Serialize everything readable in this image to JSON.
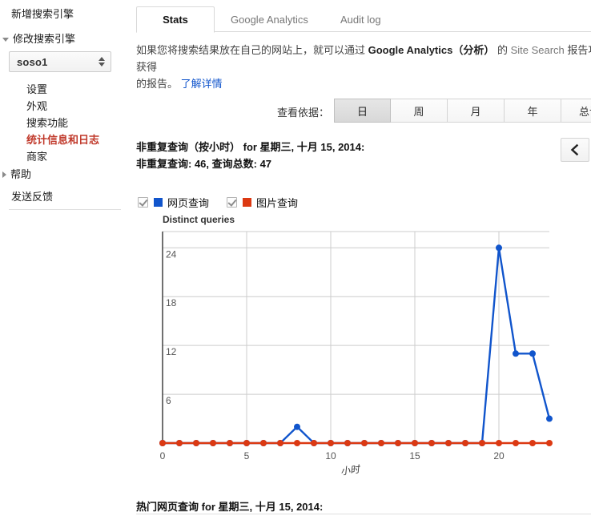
{
  "sidebar": {
    "add_engine": "新增搜索引擎",
    "edit_engine": "修改搜索引擎",
    "engine_select_value": "soso1",
    "sub_items": [
      {
        "label": "设置",
        "active": false
      },
      {
        "label": "外观",
        "active": false
      },
      {
        "label": "搜索功能",
        "active": false
      },
      {
        "label": "统计信息和日志",
        "active": true
      },
      {
        "label": "商家",
        "active": false
      }
    ],
    "help": "帮助",
    "send_feedback": "发送反馈"
  },
  "tabs": [
    {
      "label": "Stats",
      "active": true
    },
    {
      "label": "Google Analytics",
      "active": false
    },
    {
      "label": "Audit log",
      "active": false
    }
  ],
  "intro": {
    "part1": "如果您将搜索结果放在自己的网站上，就可以通过 ",
    "brand": "Google Analytics（分析）",
    "part2": " 的 ",
    "feature": "Site Search",
    "part3": " 报告功能获得",
    "part4": "的报告。",
    "link": "了解详情"
  },
  "range": {
    "label": "查看依据：",
    "options": [
      {
        "label": "日",
        "selected": true
      },
      {
        "label": "周",
        "selected": false
      },
      {
        "label": "月",
        "selected": false
      },
      {
        "label": "年",
        "selected": false
      },
      {
        "label": "总计",
        "selected": false
      }
    ]
  },
  "chart_header": {
    "title": "非重复查询（按小时） for 星期三, 十月 15, 2014:",
    "subtitle": "非重复查询: 46, 查询总数: 47",
    "back_icon": "chevron-left-icon"
  },
  "legend": [
    {
      "label": "网页查询",
      "color": "#1155cc",
      "checked": true
    },
    {
      "label": "图片查询",
      "color": "#dc3912",
      "checked": true
    }
  ],
  "chart_data": {
    "type": "line",
    "title": "Distinct queries",
    "xlabel": "小时",
    "ylabel": "Distinct queries",
    "x": [
      0,
      1,
      2,
      3,
      4,
      5,
      6,
      7,
      8,
      9,
      10,
      11,
      12,
      13,
      14,
      15,
      16,
      17,
      18,
      19,
      20,
      21,
      22,
      23
    ],
    "xticks": [
      0,
      5,
      10,
      15,
      20
    ],
    "yticks": [
      0,
      6,
      12,
      18,
      24
    ],
    "xlim": [
      0,
      23
    ],
    "ylim": [
      0,
      26
    ],
    "grid": true,
    "legend_position": "top",
    "series": [
      {
        "name": "网页查询",
        "color": "#1155cc",
        "values": [
          0,
          0,
          0,
          0,
          0,
          0,
          0,
          0,
          2,
          0,
          0,
          0,
          0,
          0,
          0,
          0,
          0,
          0,
          0,
          0,
          24,
          11,
          11,
          3
        ]
      },
      {
        "name": "图片查询",
        "color": "#dc3912",
        "values": [
          0,
          0,
          0,
          0,
          0,
          0,
          0,
          0,
          0,
          0,
          0,
          0,
          0,
          0,
          0,
          0,
          0,
          0,
          0,
          0,
          0,
          0,
          0,
          0
        ]
      }
    ]
  },
  "bottom": {
    "title": "热门网页查询 for 星期三, 十月 15, 2014:"
  }
}
